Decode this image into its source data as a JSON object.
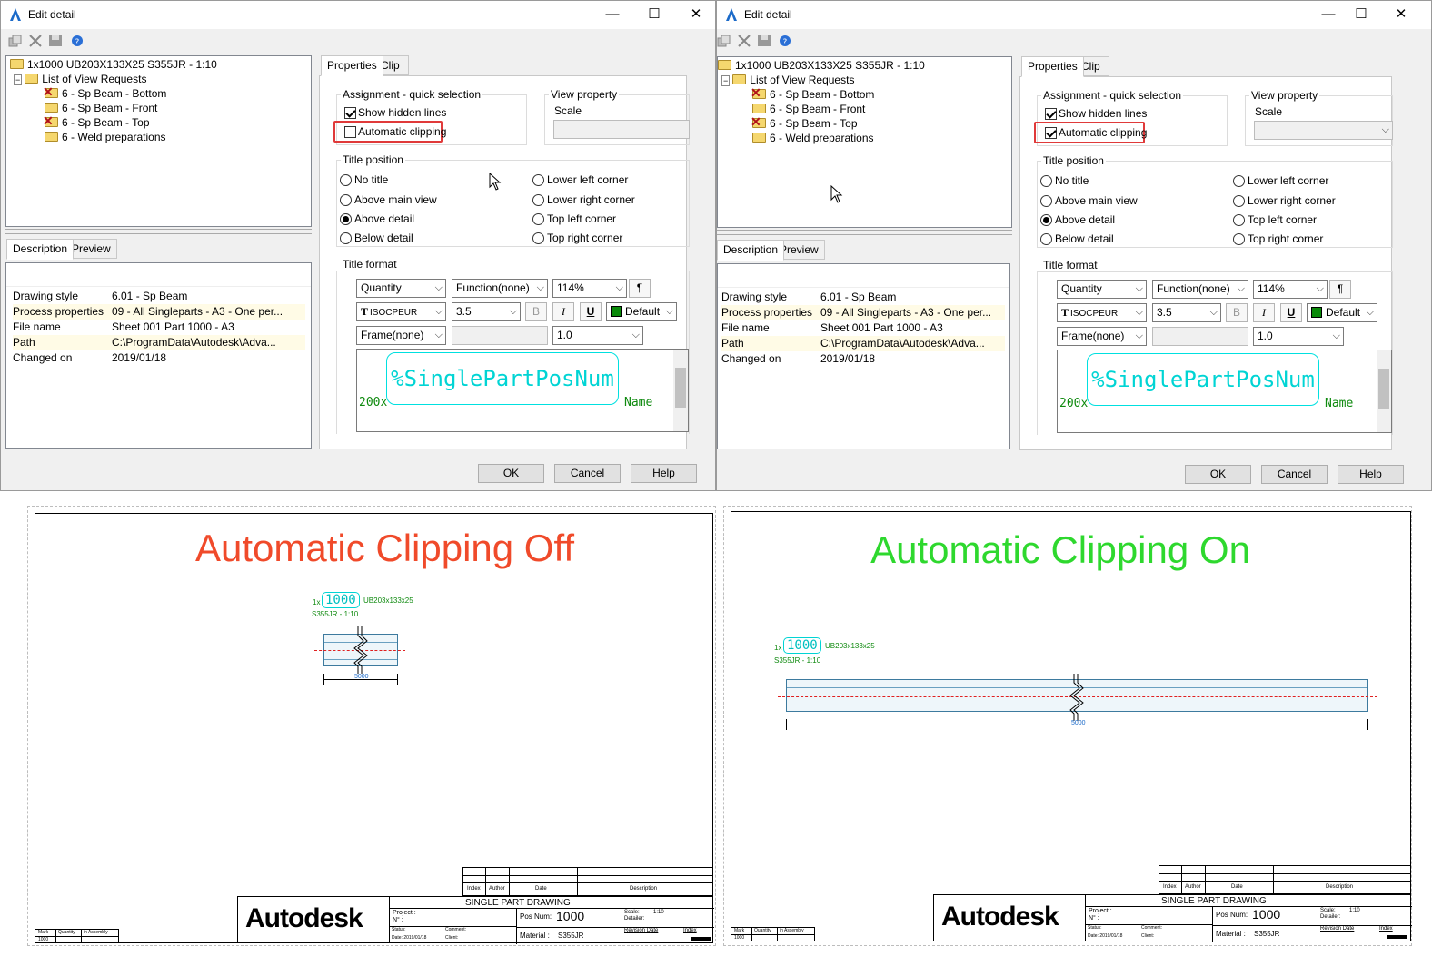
{
  "dialog": {
    "title": "Edit detail",
    "tree": {
      "root": "1x1000 UB203X133X25 S355JR - 1:10",
      "group": "List of View Requests",
      "items": [
        "6 - Sp Beam - Bottom",
        "6 - Sp Beam - Front",
        "6 - Sp Beam - Top",
        "6 - Weld preparations"
      ]
    },
    "tabs_left": [
      "Description",
      "Preview"
    ],
    "description": [
      {
        "key": "Drawing style",
        "value": "6.01 - Sp Beam"
      },
      {
        "key": "Process properties",
        "value": "09 - All Singleparts - A3 - One per..."
      },
      {
        "key": "File name",
        "value": "Sheet 001 Part 1000 - A3"
      },
      {
        "key": "Path",
        "value": "C:\\ProgramData\\Autodesk\\Adva..."
      },
      {
        "key": "Changed on",
        "value": "2019/01/18"
      }
    ],
    "tabs_right": [
      "Properties",
      "Clip"
    ],
    "assignment_label": "Assignment - quick selection",
    "show_hidden_lines": "Show hidden lines",
    "automatic_clipping": "Automatic clipping",
    "view_property_label": "View property",
    "scale_label": "Scale",
    "title_position_label": "Title position",
    "radios": [
      "No title",
      "Above main view",
      "Above detail",
      "Below detail",
      "Lower left corner",
      "Lower right corner",
      "Top left corner",
      "Top right corner"
    ],
    "title_format_label": "Title format",
    "format": {
      "quantity": "Quantity",
      "function": "Function(none)",
      "percent": "114%",
      "font": "ISOCPEUR",
      "size": "3.5",
      "bold": "B",
      "italic": "I",
      "underline": "U",
      "color": "Default",
      "frame": "Frame(none)",
      "spacing": "1.0",
      "para": "¶"
    },
    "preview": {
      "main": "%SinglePartPosNum",
      "left": "200x",
      "right": "Name"
    },
    "buttons": {
      "ok": "OK",
      "cancel": "Cancel",
      "help": "Help"
    },
    "minimize": "—",
    "maximize": "☐",
    "close": "✕"
  },
  "left_dialog_state": {
    "automatic_clipping_checked": false,
    "show_hidden_lines_checked": true
  },
  "right_dialog_state": {
    "automatic_clipping_checked": true,
    "show_hidden_lines_checked": true
  },
  "drawings": {
    "off_title": "Automatic Clipping Off",
    "on_title": "Automatic Clipping On",
    "off_color": "#f04a2a",
    "on_color": "#2ed82e",
    "label_qty": "1x",
    "label_pos": "1000",
    "label_profile": "UB203x133x25",
    "label_material": "S355JR - 1:10",
    "dim_value": "5000",
    "titleblock": {
      "logo": "Autodesk",
      "drawing_type": "SINGLE PART DRAWING",
      "project": "Project :",
      "number": "N° :",
      "pos_num_label": "Pos Num:",
      "pos_num": "1000",
      "material_label": "Material :",
      "material": "S355JR",
      "scale_label": "Scale:",
      "scale": "1:10",
      "detailer": "Detailer:",
      "revision_date": "Revision Date",
      "index": "Index",
      "status": "Status:",
      "date": "Date: 2019/01/18",
      "comment": "Comment:",
      "client": "Client:",
      "rev_headers": [
        "Index",
        "Author",
        "Date",
        "Description"
      ],
      "mark_headers": [
        "Mark",
        "Quantity",
        "in Assembly"
      ],
      "mark_value": "1000"
    }
  }
}
